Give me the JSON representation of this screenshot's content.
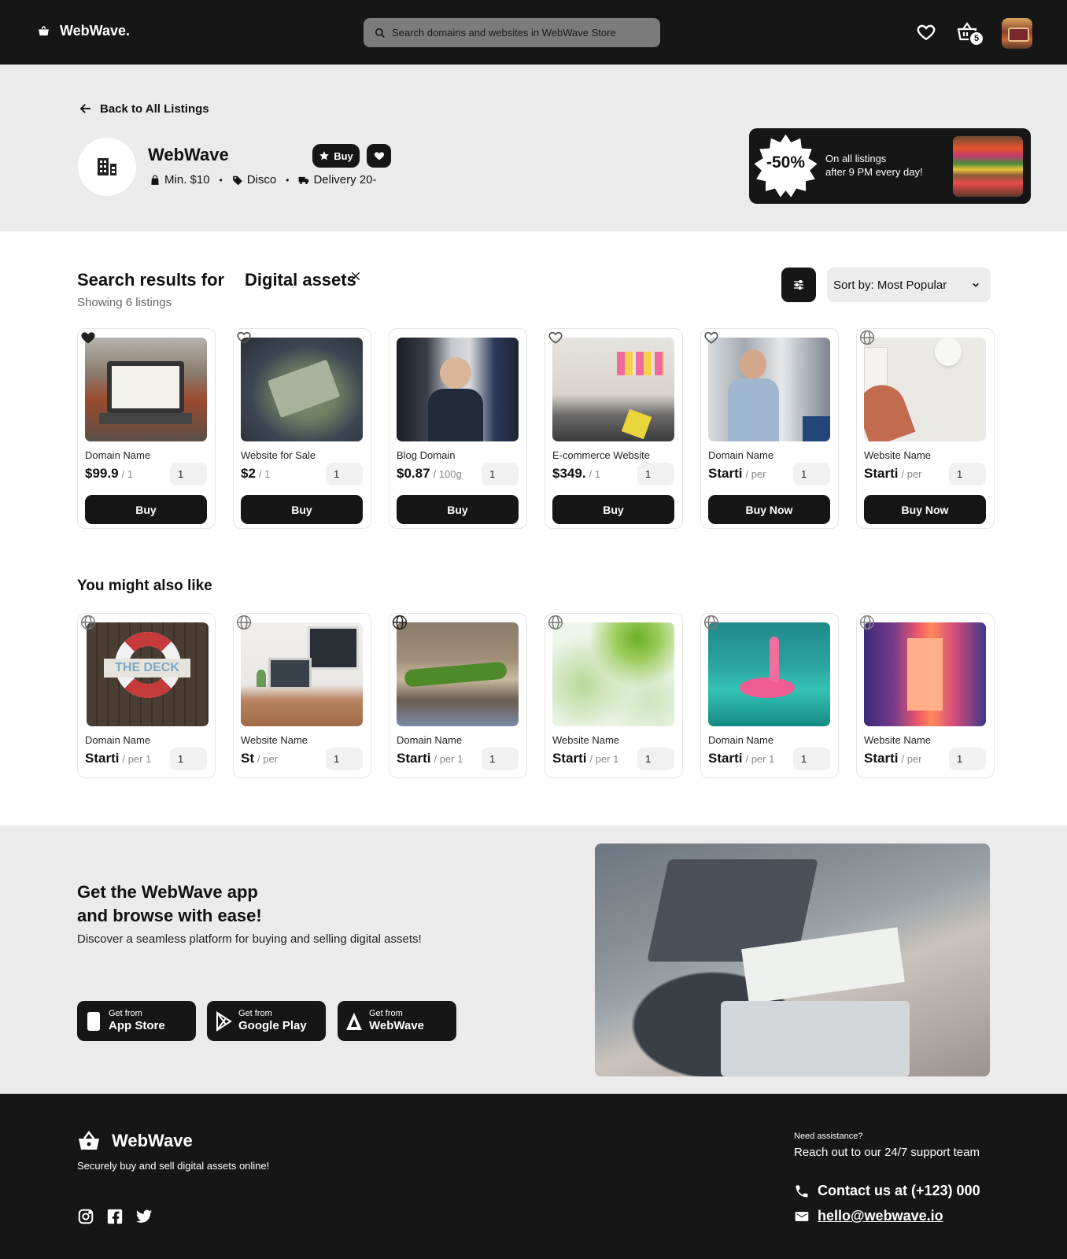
{
  "header": {
    "logo": "WebWave.",
    "search_placeholder": "Search domains and websites in WebWave Store",
    "cart_count": "5"
  },
  "banner": {
    "back_label": "Back to All Listings",
    "store_name": "WebWave",
    "buy_chip": "Buy",
    "meta": [
      "Min. $10",
      "Disco",
      "Delivery 20-"
    ],
    "promo": {
      "percent": "-50%",
      "line1": "On all listings",
      "line2": "after 9 PM every day!"
    }
  },
  "results": {
    "title": "Search results for",
    "query": "Digital assets",
    "count": "Showing 6 listings",
    "sort": "Sort by: Most Popular",
    "items": [
      {
        "name": "Domain Name",
        "price": "$99.9",
        "unit": "/ 1",
        "qty": "1",
        "button": "Buy",
        "corner": "heart-icon"
      },
      {
        "name": "Website for Sale",
        "price": "$2",
        "unit": "/ 1",
        "qty": "1",
        "button": "Buy",
        "corner": "heart-outline-icon"
      },
      {
        "name": "Blog Domain",
        "price": "$0.87",
        "unit": "/ 100g",
        "qty": "1",
        "button": "Buy",
        "corner": "none"
      },
      {
        "name": "E-commerce Website",
        "price": "$349.",
        "unit": "/ 1",
        "qty": "1",
        "button": "Buy",
        "corner": "heart-outline-icon"
      },
      {
        "name": "Domain Name",
        "price": "Starti",
        "unit": "/ per",
        "qty": "1",
        "button": "Buy Now",
        "corner": "heart-outline-icon"
      },
      {
        "name": "Website Name",
        "price": "Starti",
        "unit": "/ per",
        "qty": "1",
        "button": "Buy Now",
        "corner": "globe-icon"
      }
    ]
  },
  "also_like": {
    "title": "You might also like",
    "items": [
      {
        "name": "Domain Name",
        "price": "Starti",
        "unit": "/ per 1",
        "qty": "1"
      },
      {
        "name": "Website Name",
        "price": "St",
        "unit": "/ per",
        "qty": "1"
      },
      {
        "name": "Domain Name",
        "price": "Starti",
        "unit": "/ per 1",
        "qty": "1"
      },
      {
        "name": "Website Name",
        "price": "Starti",
        "unit": "/ per 1",
        "qty": "1"
      },
      {
        "name": "Domain Name",
        "price": "Starti",
        "unit": "/ per 1",
        "qty": "1"
      },
      {
        "name": "Website Name",
        "price": "Starti",
        "unit": "/ per",
        "qty": "1"
      }
    ]
  },
  "app": {
    "heading_line1": "Get the WebWave app",
    "heading_line2": "and browse with ease!",
    "subtitle": "Discover a seamless platform for buying and selling digital assets!",
    "stores": [
      {
        "top": "Get from",
        "name": "App Store"
      },
      {
        "top": "Get from",
        "name": "Google Play"
      },
      {
        "top": "Get from",
        "name": "WebWave"
      }
    ]
  },
  "footer": {
    "brand": "WebWave",
    "tagline": "Securely buy and sell digital assets online!",
    "need": "Need assistance?",
    "reach": "Reach out to our 24/7 support team",
    "contact": "Contact us at (+123) 000",
    "email": "hello@webwave.io"
  }
}
